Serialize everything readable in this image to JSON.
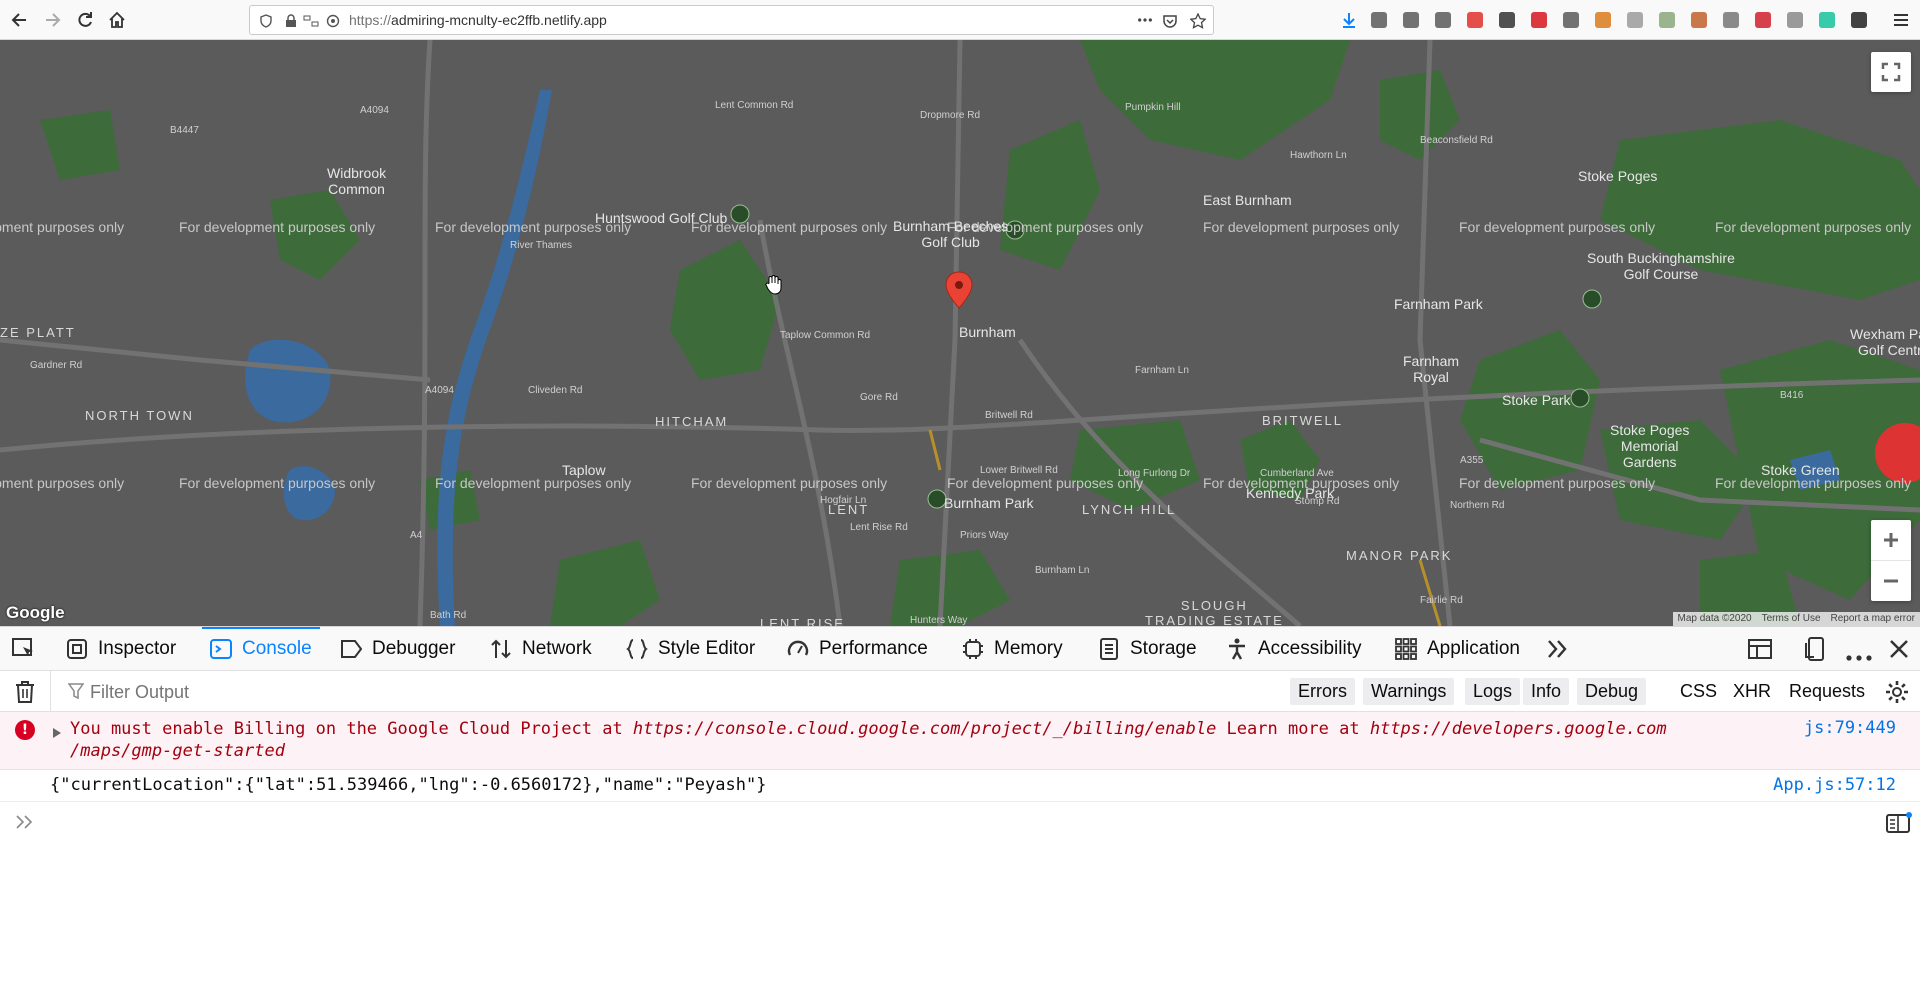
{
  "browser": {
    "url_scheme": "https://",
    "url_host": "admiring-mcnulty-ec2ffb.netlify.app",
    "extension_icons": [
      "downloads-icon",
      "library-icon",
      "sidebar-icon",
      "account-icon",
      "adblock-icon",
      "lock-ext-icon",
      "pdf-ext-icon",
      "barcode-ext-icon",
      "orange-ext-icon",
      "rainbow-ext-icon",
      "paint-ext-icon",
      "cookie-ext-icon",
      "s-ext-icon",
      "red-s-ext-icon",
      "gray-ext-icon",
      "grammarly-icon",
      "notion-icon",
      "menu-icon"
    ],
    "ext_colors": [
      "#0a84ff",
      "#5a5a5a",
      "#5a5a5a",
      "#5a5a5a",
      "#e1312a",
      "#333333",
      "#d7161d",
      "#5a5a5a",
      "#d97b1a",
      "#9b9b9b",
      "#8aa87a",
      "#c0612b",
      "#777777",
      "#d0202b",
      "#8a8a8a",
      "#15c39a",
      "#222222",
      "#333333"
    ]
  },
  "map": {
    "watermark": "For development purposes only",
    "places": [
      {
        "name": "Widbrook\nCommon",
        "caps": false
      },
      {
        "name": "Huntswood Golf Club",
        "caps": false
      },
      {
        "name": "Burnham Beeches\nGolf Club",
        "caps": false
      },
      {
        "name": "East Burnham",
        "caps": false
      },
      {
        "name": "Stoke Poges",
        "caps": false
      },
      {
        "name": "South Buckinghamshire\nGolf Course",
        "caps": false
      },
      {
        "name": "Farnham Park",
        "caps": false
      },
      {
        "name": "Wexham Park\nGolf Centre",
        "caps": false
      },
      {
        "name": "Burnham",
        "caps": false
      },
      {
        "name": "ZE PLATT",
        "caps": true
      },
      {
        "name": "NORTH TOWN",
        "caps": true
      },
      {
        "name": "HITCHAM",
        "caps": true
      },
      {
        "name": "Taplow",
        "caps": false
      },
      {
        "name": "Farnham\nRoyal",
        "caps": false
      },
      {
        "name": "BRITWELL",
        "caps": true
      },
      {
        "name": "Stoke Park",
        "caps": false
      },
      {
        "name": "Stoke Poges\nMemorial\nGardens",
        "caps": false
      },
      {
        "name": "Stoke Green",
        "caps": false
      },
      {
        "name": "Kennedy Park",
        "caps": false
      },
      {
        "name": "LENT",
        "caps": true
      },
      {
        "name": "Burnham Park",
        "caps": false
      },
      {
        "name": "LYNCH HILL",
        "caps": true
      },
      {
        "name": "MANOR PARK",
        "caps": true
      },
      {
        "name": "SLOUGH\nTRADING ESTATE",
        "caps": true
      },
      {
        "name": "LENT RISE",
        "caps": true
      }
    ],
    "roads": [
      "A4094",
      "Dropmore Rd",
      "Pumpkin Hill",
      "Hawthorn Ln",
      "Beaconsfield Rd",
      "B4447",
      "Gardner Rd",
      "Gore Rd",
      "Britwell Rd",
      "Farnham Ln",
      "Long Furlong Dr",
      "Cumberland Ave",
      "Stomp Rd",
      "Lent Rise Rd",
      "Hogfair Ln",
      "Lower Britwell Rd",
      "A355",
      "B416",
      "Taplow Common Rd",
      "Cliveden Rd",
      "River Thames",
      "Bath Rd",
      "A4",
      "Burnham Ln",
      "Northern Rd",
      "Fairlie Rd",
      "Priors Way",
      "Hunters Way",
      "Lent Common Rd",
      "A4094"
    ],
    "attribution": [
      "Map data ©2020",
      "Terms of Use",
      "Report a map error"
    ],
    "google_logo": "Google",
    "colors": {
      "land": "#5b5b5b",
      "park": "#3d6b3a",
      "water": "#3b6a9e",
      "road": "#6f6f6f",
      "pin": "#ea4335"
    }
  },
  "devtools": {
    "tabs": [
      {
        "label": "Inspector",
        "icon": "inspector-icon"
      },
      {
        "label": "Console",
        "icon": "console-icon",
        "active": true
      },
      {
        "label": "Debugger",
        "icon": "debugger-icon"
      },
      {
        "label": "Network",
        "icon": "network-icon"
      },
      {
        "label": "Style Editor",
        "icon": "style-editor-icon"
      },
      {
        "label": "Performance",
        "icon": "performance-icon"
      },
      {
        "label": "Memory",
        "icon": "memory-icon"
      },
      {
        "label": "Storage",
        "icon": "storage-icon"
      },
      {
        "label": "Accessibility",
        "icon": "accessibility-icon"
      },
      {
        "label": "Application",
        "icon": "application-icon"
      }
    ],
    "filter_placeholder": "Filter Output",
    "filter_buttons": [
      "Errors",
      "Warnings",
      "Logs",
      "Info",
      "Debug"
    ],
    "request_buttons": [
      "CSS",
      "XHR",
      "Requests"
    ],
    "messages": [
      {
        "level": "error",
        "text_parts": [
          {
            "t": "You must enable Billing on the Google Cloud Project at ",
            "link": false
          },
          {
            "t": "https://console.cloud.google.com/project/_/billing/enable",
            "link": true
          },
          {
            "t": " Learn more at ",
            "link": false
          },
          {
            "t": "https://developers.google.com\n/maps/gmp-get-started",
            "link": true
          }
        ],
        "source": "js:79:449"
      },
      {
        "level": "log",
        "text": "{\"currentLocation\":{\"lat\":51.539466,\"lng\":-0.6560172},\"name\":\"Peyash\"}",
        "source": "App.js:57:12"
      }
    ]
  }
}
